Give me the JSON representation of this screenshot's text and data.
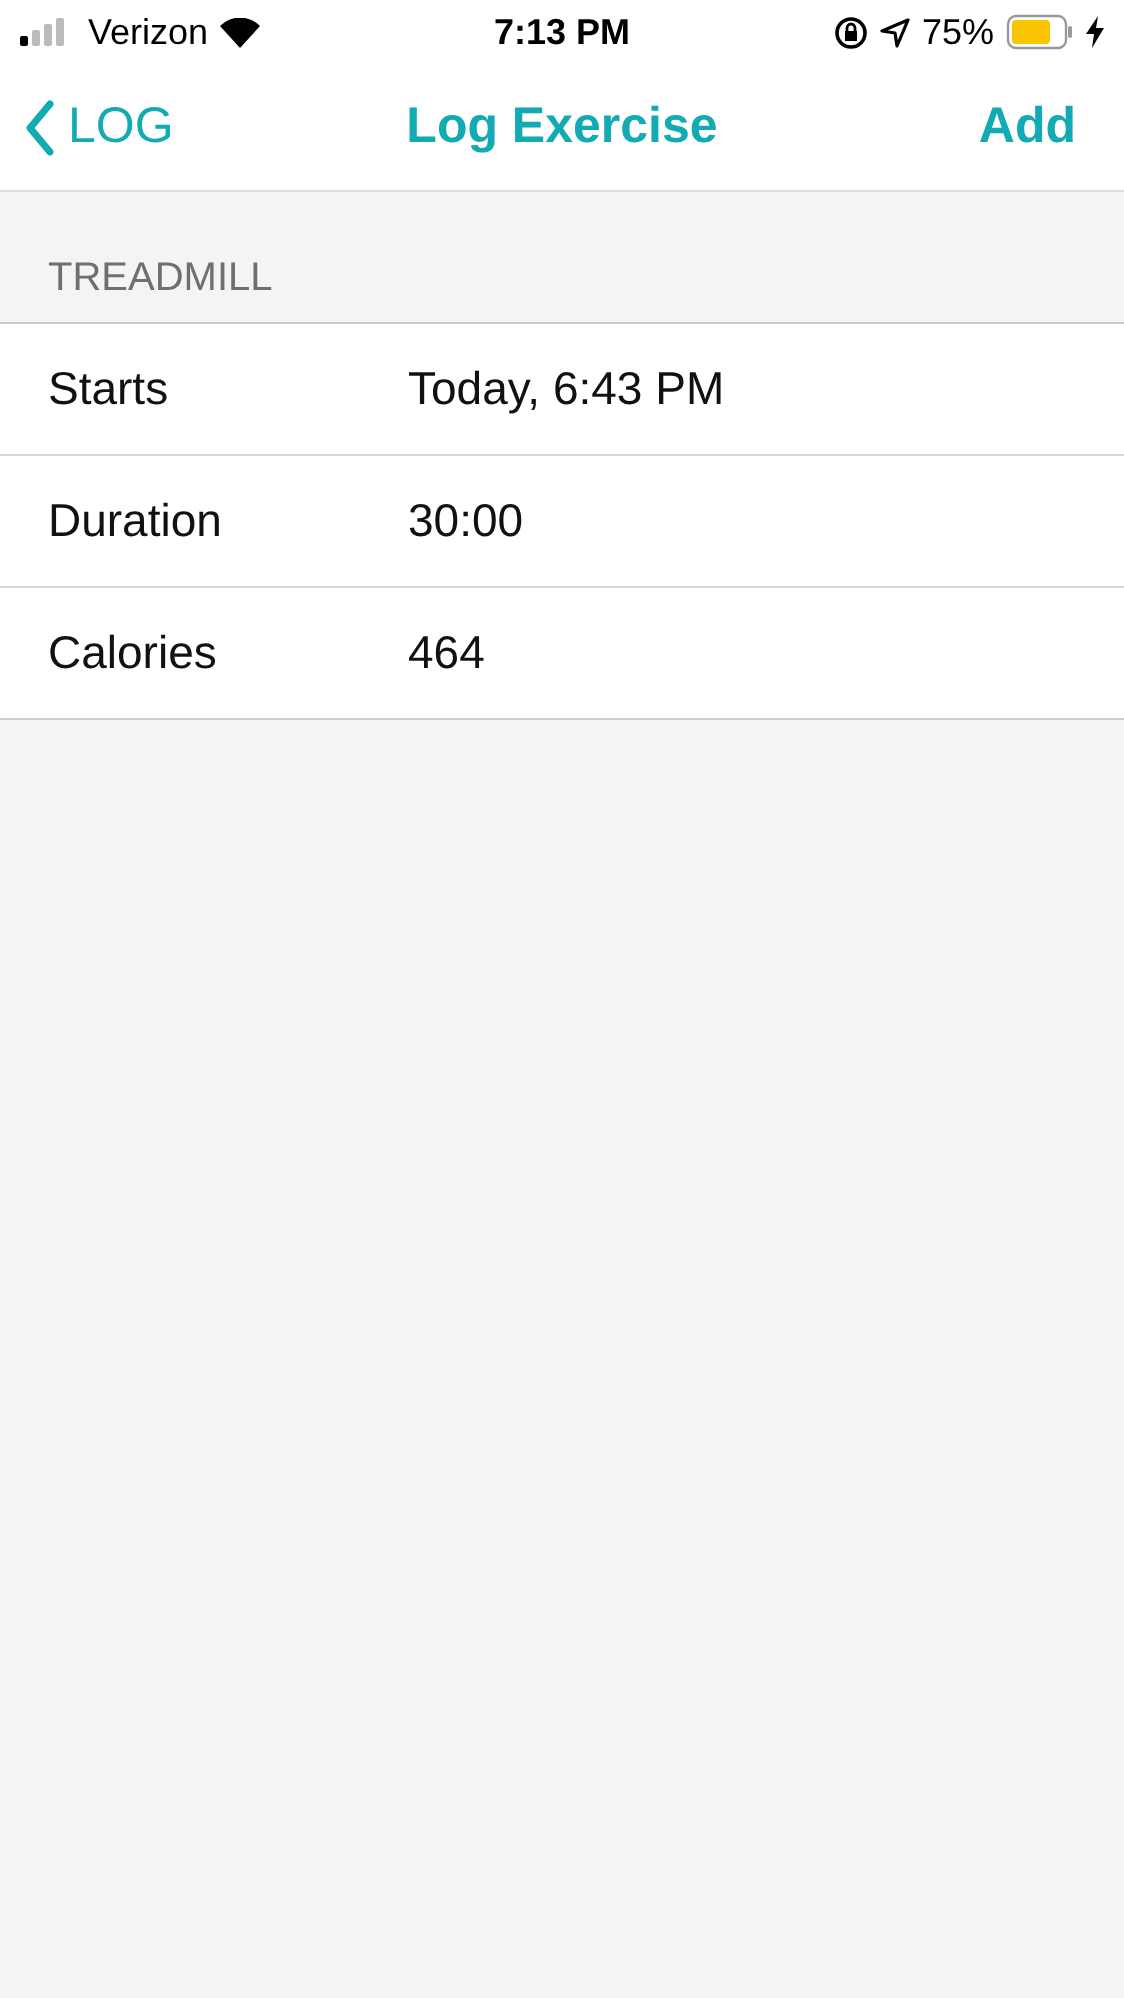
{
  "status_bar": {
    "carrier": "Verizon",
    "time": "7:13 PM",
    "battery": "75%"
  },
  "nav": {
    "back": "LOG",
    "title": "Log Exercise",
    "action": "Add"
  },
  "section": {
    "header": "TREADMILL",
    "rows": [
      {
        "label": "Starts",
        "value": "Today, 6:43 PM"
      },
      {
        "label": "Duration",
        "value": "30:00"
      },
      {
        "label": "Calories",
        "value": "464"
      }
    ]
  }
}
